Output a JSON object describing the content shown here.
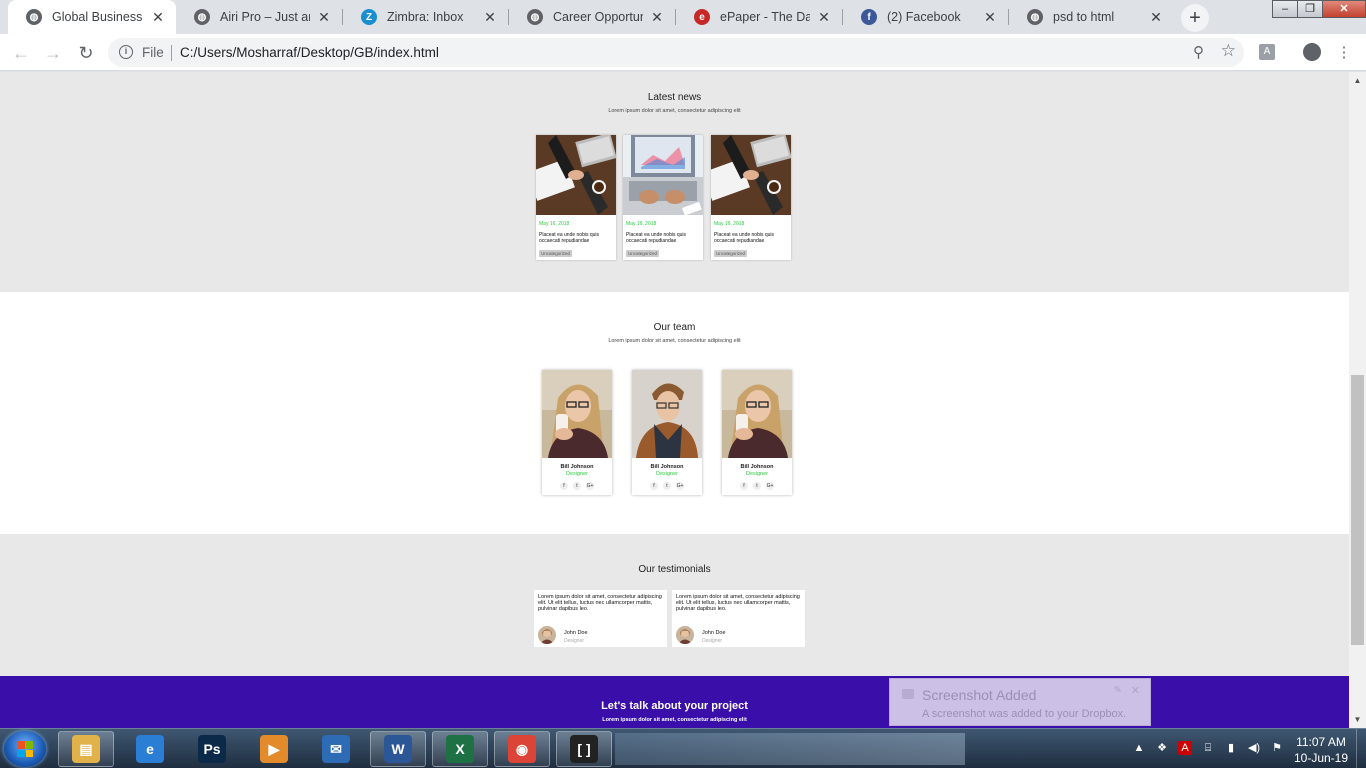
{
  "tabs": [
    {
      "title": "Global Business",
      "favicon": "globe-icon",
      "color": "#5f6368",
      "glyph": "◍",
      "active": true
    },
    {
      "title": "Airi Pro – Just anot",
      "favicon": "globe-icon",
      "color": "#5f6368",
      "glyph": "◍"
    },
    {
      "title": "Zimbra: Inbox",
      "favicon": "zimbra-icon",
      "color": "#1a8fcf",
      "glyph": "Z"
    },
    {
      "title": "Career Opportunity",
      "favicon": "globe-icon",
      "color": "#5f6368",
      "glyph": "◍"
    },
    {
      "title": "ePaper - The Daily",
      "favicon": "epaper-icon",
      "color": "#c62828",
      "glyph": "e"
    },
    {
      "title": "(2) Facebook",
      "favicon": "facebook-icon",
      "color": "#3b5998",
      "glyph": "f"
    },
    {
      "title": "psd to html",
      "favicon": "globe-icon",
      "color": "#5f6368",
      "glyph": "◍"
    }
  ],
  "address": {
    "scheme": "File",
    "url": "C:/Users/Mosharraf/Desktop/GB/index.html"
  },
  "page": {
    "news": {
      "title": "Latest news",
      "subtitle": "Lorem ipsum dolor sit amet, consectetur adipiscing elit",
      "cards": [
        {
          "date": "May 16, 2018",
          "title": "Placeat ea unde nobis quis occaecati repudiandae",
          "tag": "Uncategorized",
          "image": "handshake-photo"
        },
        {
          "date": "May 16, 2018",
          "title": "Placeat ea unde nobis quis occaecati repudiandae",
          "tag": "Uncategorized",
          "image": "laptop-photo"
        },
        {
          "date": "May 16, 2018",
          "title": "Placeat ea unde nobis quis occaecati repudiandae",
          "tag": "Uncategorized",
          "image": "handshake-photo"
        }
      ]
    },
    "team": {
      "title": "Our team",
      "subtitle": "Lorem ipsum dolor sit amet, consectetur adipiscing elit",
      "members": [
        {
          "name": "Bill Johnson",
          "role": "Designer",
          "photo": "woman-photo"
        },
        {
          "name": "Bill Johnson",
          "role": "Designer",
          "photo": "man-photo"
        },
        {
          "name": "Bill Johnson",
          "role": "Designer",
          "photo": "woman-photo"
        }
      ],
      "social": [
        "f",
        "t",
        "G+"
      ]
    },
    "testimonials": {
      "title": "Our testimonials",
      "items": [
        {
          "text": "Lorem ipsum dolor sit amet, consectetur adipiscing elit. Ut elit tellus, luctus nec ullamcorper mattis, pulvinar dapibus leo.",
          "name": "John Doe",
          "role": "Designer"
        },
        {
          "text": "Lorem ipsum dolor sit amet, consectetur adipiscing elit. Ut elit tellus, luctus nec ullamcorper mattis, pulvinar dapibus leo.",
          "name": "John Doe",
          "role": "Designer"
        }
      ]
    },
    "cta": {
      "title": "Let's talk about your project",
      "subtitle": "Lorem ipsum dolor sit amet, consectetur adipiscing elit"
    }
  },
  "toast": {
    "title": "Screenshot Added",
    "message": "A screenshot was added to your Dropbox."
  },
  "taskbar": {
    "apps": [
      {
        "name": "explorer",
        "color": "#e2b24a",
        "glyph": "▤"
      },
      {
        "name": "internet-explorer",
        "color": "#2a7fd4",
        "glyph": "e"
      },
      {
        "name": "photoshop",
        "color": "#0b2a4a",
        "glyph": "Ps"
      },
      {
        "name": "media-player",
        "color": "#e38b2b",
        "glyph": "▶"
      },
      {
        "name": "thunderbird",
        "color": "#2d6bb5",
        "glyph": "✉"
      },
      {
        "name": "word",
        "color": "#2b5797",
        "glyph": "W"
      },
      {
        "name": "excel",
        "color": "#1e7145",
        "glyph": "X"
      },
      {
        "name": "chrome",
        "color": "#db4437",
        "glyph": "◉"
      },
      {
        "name": "brackets",
        "color": "#222222",
        "glyph": "[ ]"
      }
    ],
    "time": "11:07 AM",
    "date": "10-Jun-19"
  }
}
